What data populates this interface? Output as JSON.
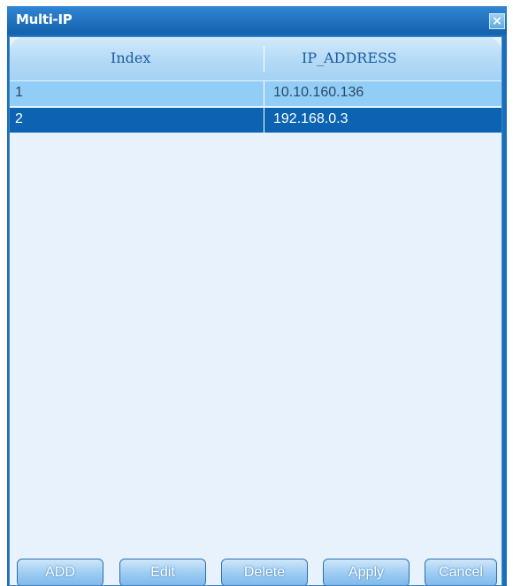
{
  "window": {
    "title": "Multi-IP",
    "close_glyph": "×"
  },
  "table": {
    "columns": [
      "Index",
      "IP_ADDRESS"
    ],
    "rows": [
      {
        "index": "1",
        "ip": "10.10.160.136",
        "selected": false
      },
      {
        "index": "2",
        "ip": "192.168.0.3",
        "selected": true
      }
    ]
  },
  "buttons": {
    "add": "ADD",
    "edit": "Edit",
    "delete": "Delete",
    "apply": "Apply",
    "cancel": "Cancel"
  },
  "colors": {
    "titlebar": "#1a6fbd",
    "selected_row": "#0b63b2",
    "row": "#92cdf7",
    "panel": "#e7f2fc"
  }
}
